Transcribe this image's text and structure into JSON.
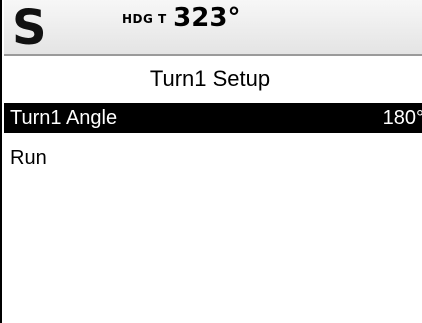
{
  "status_bar": {
    "logo_text": "S",
    "heading_label": "HDG T",
    "heading_value": "323°"
  },
  "page": {
    "title": "Turn1 Setup"
  },
  "menu": {
    "items": [
      {
        "label": "Turn1 Angle",
        "value": "180°",
        "selected": true
      },
      {
        "label": "Run",
        "value": "",
        "selected": false
      }
    ]
  }
}
